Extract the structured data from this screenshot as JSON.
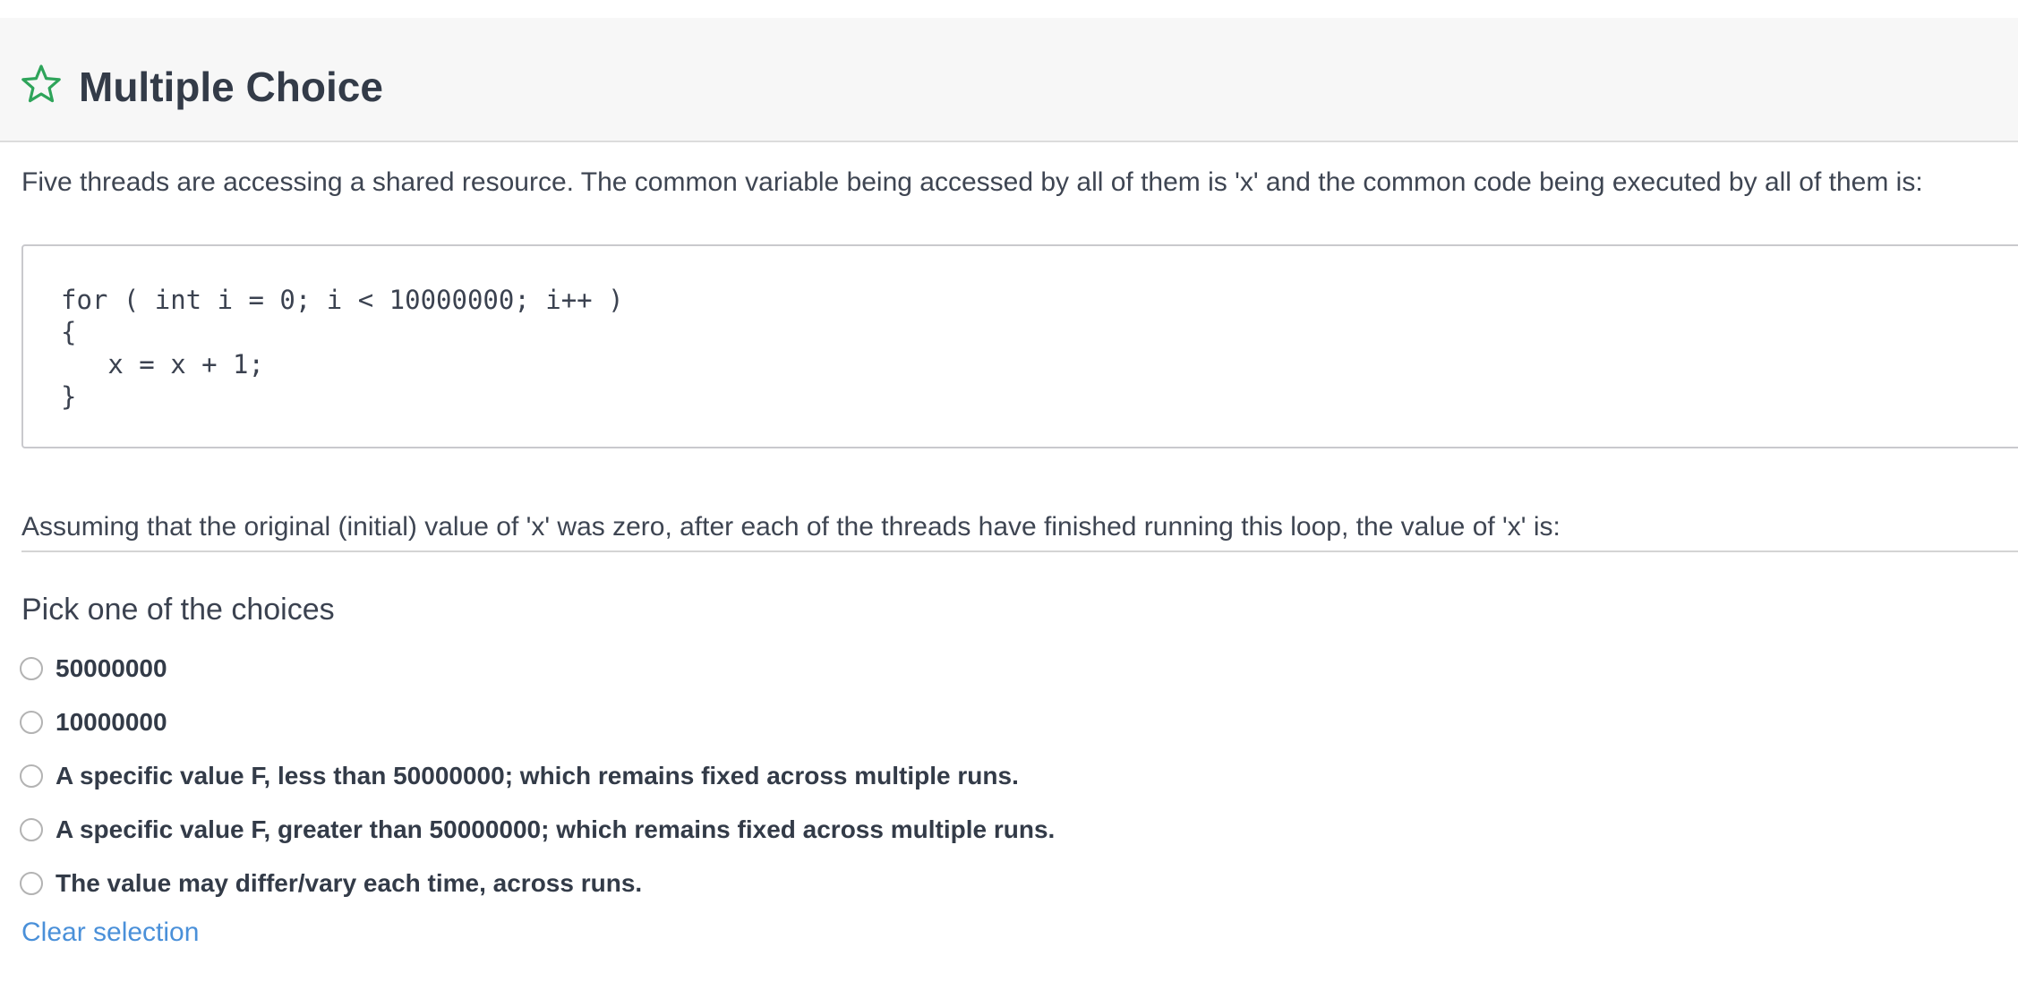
{
  "header": {
    "title": "Multiple Choice",
    "icon": "star-icon",
    "icon_color": "#2ea45a"
  },
  "question": {
    "intro": "Five threads are accessing a shared resource. The common variable being accessed by all of them is 'x' and the common code being executed by all of them is:",
    "code": "for ( int i = 0; i < 10000000; i++ )\n{\n   x = x + 1;\n}",
    "followup": "Assuming that the original (initial) value of 'x' was zero, after each of the threads have finished running this loop, the value of 'x' is:"
  },
  "choices": {
    "heading": "Pick one of the choices",
    "options": [
      {
        "label": "50000000",
        "selected": false
      },
      {
        "label": "10000000",
        "selected": false
      },
      {
        "label": "A specific value F, less than 50000000; which remains fixed across multiple runs.",
        "selected": false
      },
      {
        "label": "A specific value F, greater than 50000000; which remains fixed across multiple runs.",
        "selected": false
      },
      {
        "label": "The value may differ/vary each time, across runs.",
        "selected": false
      }
    ],
    "clear_label": "Clear selection"
  },
  "colors": {
    "link": "#4a90d9",
    "header_bg": "#f7f7f7",
    "text": "#3b4250"
  }
}
